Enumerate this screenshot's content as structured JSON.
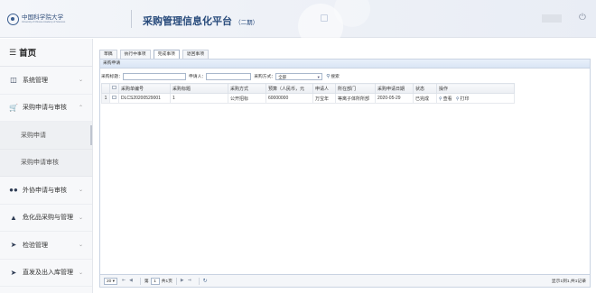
{
  "header": {
    "logo_text": "中国科学院大学",
    "logo_sub": "University of Chinese Academy of Sciences",
    "title": "采购管理信息化平台",
    "title_suffix": "（二期）"
  },
  "sidebar": {
    "home": "首页",
    "items": [
      {
        "label": "系统管理",
        "icon": "folder-icon"
      },
      {
        "label": "采购申请与审核",
        "icon": "cart-icon",
        "expanded": true,
        "children": [
          "采购申请",
          "采购申请审核"
        ]
      },
      {
        "label": "外协申请与审核",
        "icon": "group-icon"
      },
      {
        "label": "危化品采购与管理",
        "icon": "warning-icon"
      },
      {
        "label": "检验管理",
        "icon": "check-icon"
      },
      {
        "label": "直发及出入库管理",
        "icon": "truck-icon"
      }
    ]
  },
  "tabs": [
    "草稿",
    "执行中事项",
    "完成事项",
    "退回事项"
  ],
  "active_tab": "完成事项",
  "panel_title": "采购申请",
  "search": {
    "title_label": "采购标题：",
    "applicant_label": "申请人：",
    "method_label": "采购方式：",
    "method_value": "全部",
    "search_button": "搜索"
  },
  "table": {
    "columns": [
      "采购单编号",
      "采购标题",
      "采购方式",
      "预算（人民币，元",
      "申请人",
      "所在部门",
      "采购申请日期",
      "状态",
      "操作"
    ],
    "rows": [
      {
        "num": "1",
        "code": "DLCS20200529001",
        "title": "1",
        "method": "公开招标",
        "budget": "60000000",
        "applicant": "万宝年",
        "dept": "等离子体所所部",
        "date": "2020-05-29",
        "status": "已完成",
        "op_view": "查看",
        "op_print": "打印"
      }
    ]
  },
  "pager": {
    "page_size": "20",
    "page_prefix": "第",
    "page_value": "1",
    "page_total": "共1页",
    "info": "显示1到1,共1记录"
  }
}
